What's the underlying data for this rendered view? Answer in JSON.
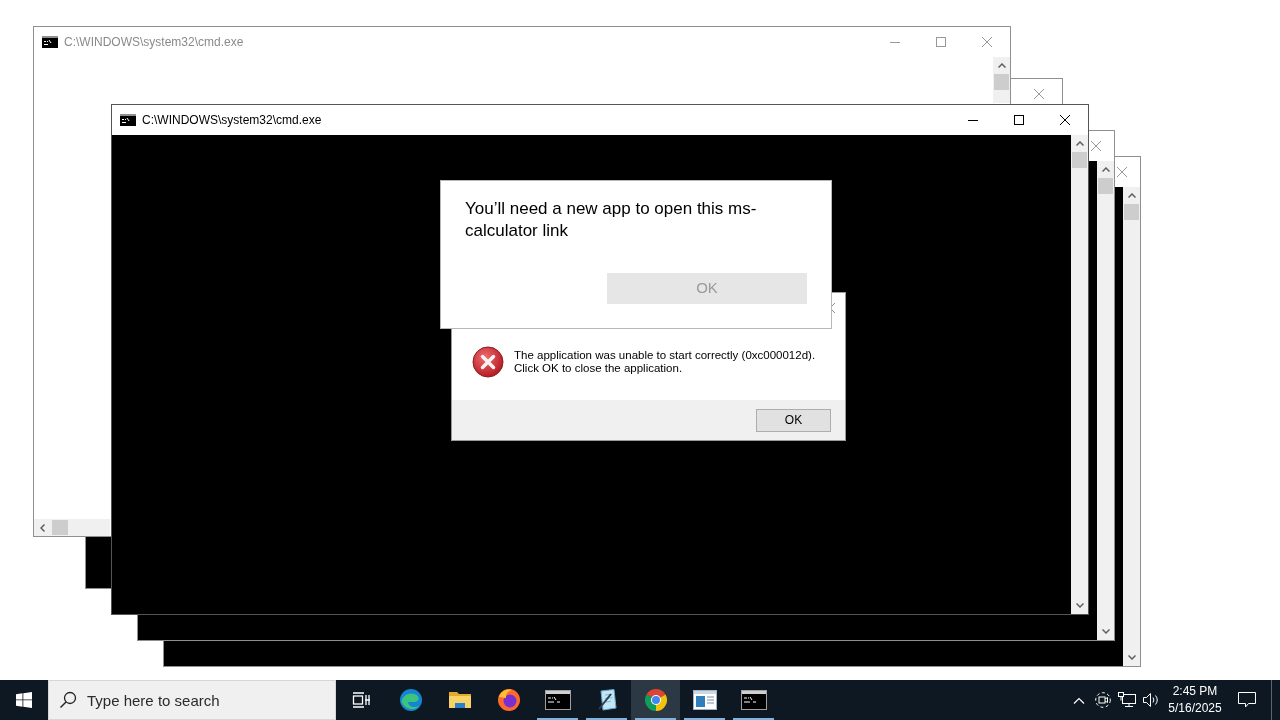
{
  "windows": [
    {
      "kind": "blank",
      "title": "C:\\WINDOWS\\system32\\cmd.exe",
      "active": false
    },
    {
      "kind": "console",
      "active": false
    },
    {
      "kind": "console",
      "title": "C:\\WINDOWS\\system32\\cmd.exe",
      "active": true
    },
    {
      "kind": "console",
      "active": false
    },
    {
      "kind": "console",
      "active": false
    }
  ],
  "app_dialog": {
    "message": "You’ll need a new app to open this ms-calculator link",
    "button": "OK"
  },
  "error_dialog": {
    "message": "The application was unable to start correctly (0xc000012d). Click OK to close the application.",
    "button": "OK"
  },
  "taskbar": {
    "search": {
      "placeholder": "Type here to search"
    },
    "apps": [
      {
        "kind": "swirl",
        "running": false,
        "selected": false
      },
      {
        "kind": "folder",
        "running": false,
        "selected": false
      },
      {
        "kind": "flame-globe",
        "running": false,
        "selected": false
      },
      {
        "kind": "terminal",
        "running": true,
        "selected": false
      },
      {
        "kind": "pen-sheet",
        "running": true,
        "selected": false
      },
      {
        "kind": "tricolor",
        "running": true,
        "selected": true
      },
      {
        "kind": "panels",
        "running": true,
        "selected": false
      },
      {
        "kind": "terminal",
        "running": true,
        "selected": false
      }
    ],
    "clock": {
      "time": "2:45 PM",
      "date": "5/16/2025"
    }
  }
}
